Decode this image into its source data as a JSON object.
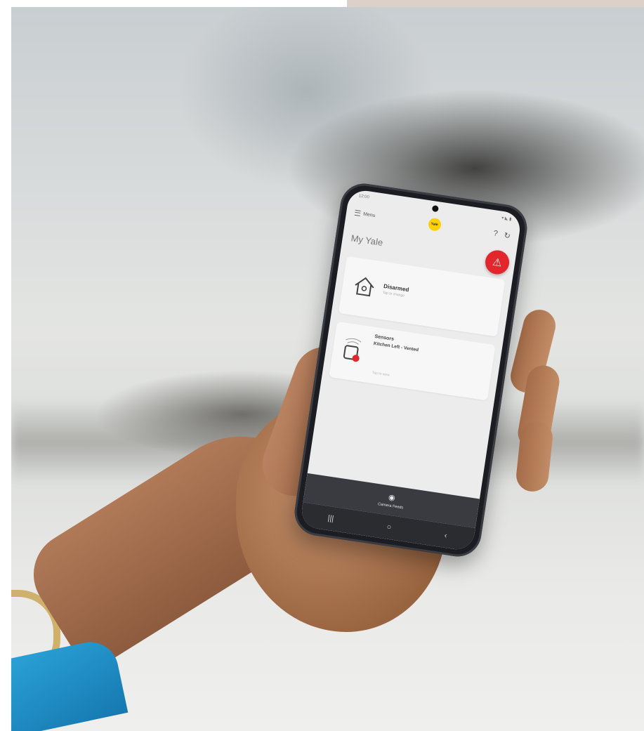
{
  "phone": {
    "status_time": "12:00",
    "status_icons": "▾ ◣ ▮",
    "menu_label": "Menu",
    "logo_text": "Yale",
    "help_icon": "?",
    "refresh_icon": "↻",
    "page_title": "My Yale",
    "alarm_card": {
      "status": "Disarmed",
      "subtitle": "Tap to change"
    },
    "sensors_card": {
      "title": "Sensors",
      "detail": "Kitchen Left - Vented",
      "subtitle": "Tap to view"
    },
    "bottom_nav": {
      "label": "Camera Feeds"
    },
    "system_nav": {
      "recents": "|||",
      "home": "○",
      "back": "‹"
    }
  }
}
